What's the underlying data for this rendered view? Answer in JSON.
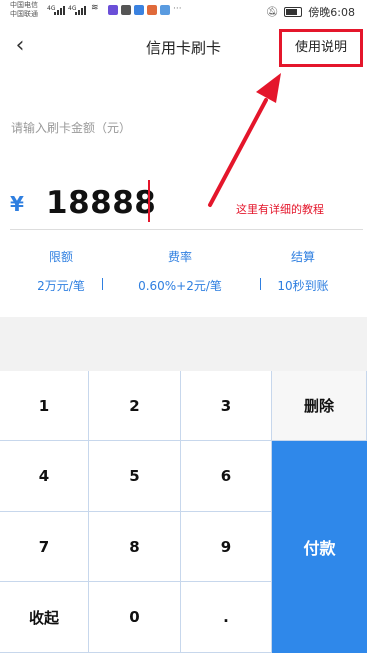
{
  "status_bar": {
    "carrier_1": "中国电信",
    "carrier_2": "中国联通",
    "signal_1": "4G",
    "signal_2": "4G",
    "more": "···",
    "time": "傍晚6:08",
    "icons": [
      "bell-off-icon",
      "battery-icon",
      "wifi-icon"
    ]
  },
  "header": {
    "back_icon": "chevron-left-icon",
    "back_glyph": "‹",
    "title": "信用卡刷卡",
    "help_label": "使用说明"
  },
  "amount": {
    "placeholder_label": "请输入刷卡金额（元）",
    "currency_symbol": "¥",
    "value": "18888",
    "annotation": "这里有详细的教程"
  },
  "info": [
    {
      "label": "限额",
      "value": "2万元/笔"
    },
    {
      "label": "费率",
      "value": "0.60%+2元/笔"
    },
    {
      "label": "结算",
      "value": "10秒到账"
    }
  ],
  "keypad": {
    "digits": [
      "1",
      "2",
      "3",
      "4",
      "5",
      "6",
      "7",
      "8",
      "9",
      "0",
      "."
    ],
    "collapse_label": "收起",
    "delete_label": "删除",
    "pay_label": "付款"
  },
  "colors": {
    "accent_blue": "#2f88ea",
    "annotation_red": "#e4162b"
  }
}
